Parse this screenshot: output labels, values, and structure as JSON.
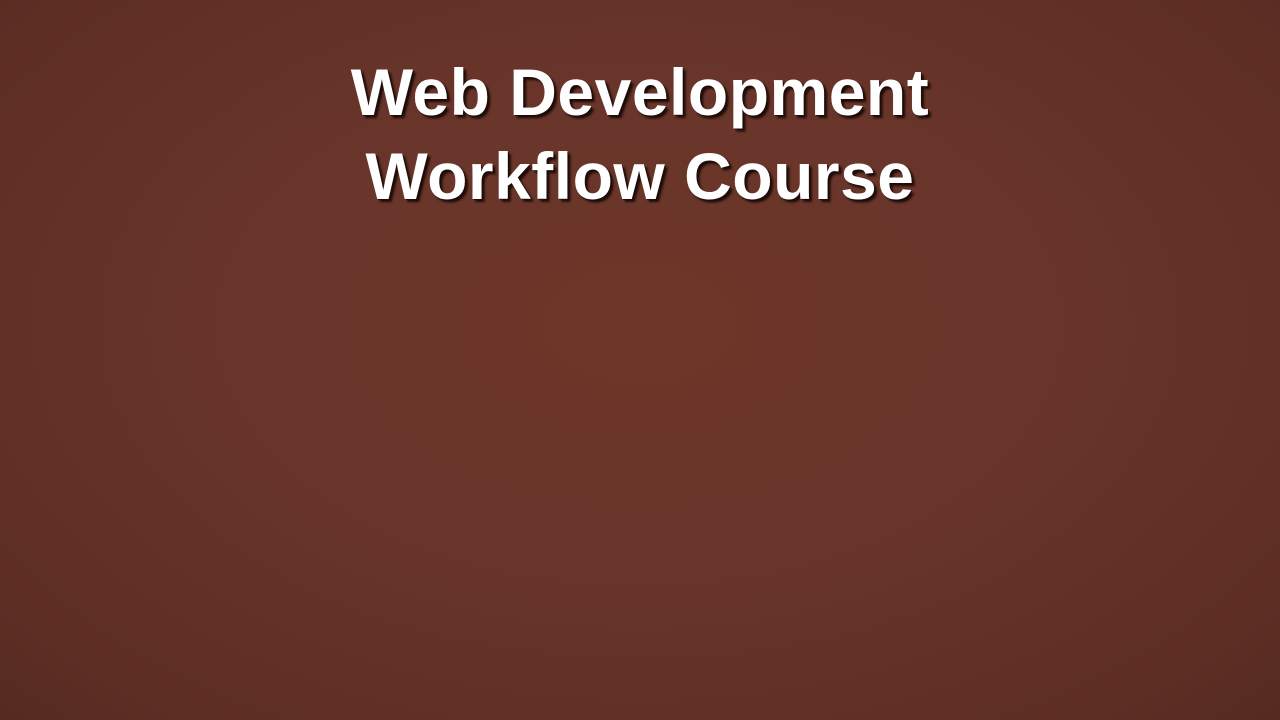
{
  "slide": {
    "title_lines": [
      "Web Development",
      "Workflow Course"
    ],
    "background_color": "#69352a",
    "title_color": "#ffffff"
  }
}
